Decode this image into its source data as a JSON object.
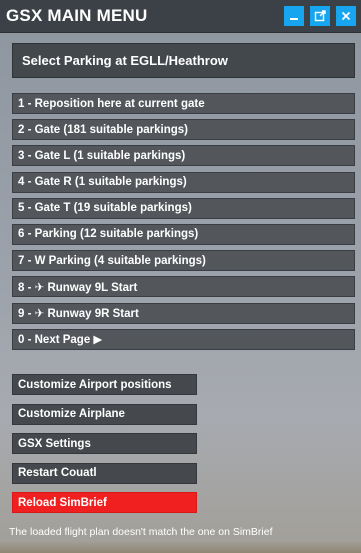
{
  "window": {
    "title": "GSX MAIN MENU",
    "buttons": [
      {
        "icon": "minimize-icon",
        "glyph": "—"
      },
      {
        "icon": "popout-icon",
        "glyph": "⧉"
      },
      {
        "icon": "close-icon",
        "glyph": "✕"
      }
    ],
    "accent": "#17a5f0"
  },
  "header": "Select Parking at EGLL/Heathrow",
  "menu": [
    "1  -  Reposition here at current gate",
    "2  -  Gate (181 suitable parkings)",
    "3  -  Gate L (1 suitable parkings)",
    "4  -  Gate R (1 suitable parkings)",
    "5  -  Gate T (19 suitable parkings)",
    "6  -  Parking (12 suitable parkings)",
    "7  -  W Parking (4 suitable parkings)",
    "8  -  ✈ Runway 9L Start",
    "9  -  ✈ Runway 9R Start",
    "0  -  Next Page ▶"
  ],
  "actions": [
    {
      "label": "Customize Airport positions",
      "alert": false
    },
    {
      "label": "Customize Airplane",
      "alert": false
    },
    {
      "label": "GSX Settings",
      "alert": false
    },
    {
      "label": "Restart Couatl",
      "alert": false
    },
    {
      "label": "Reload SimBrief",
      "alert": true
    }
  ],
  "alert_color": "#f02020",
  "warning": "The loaded flight plan doesn't match the one on SimBrief"
}
